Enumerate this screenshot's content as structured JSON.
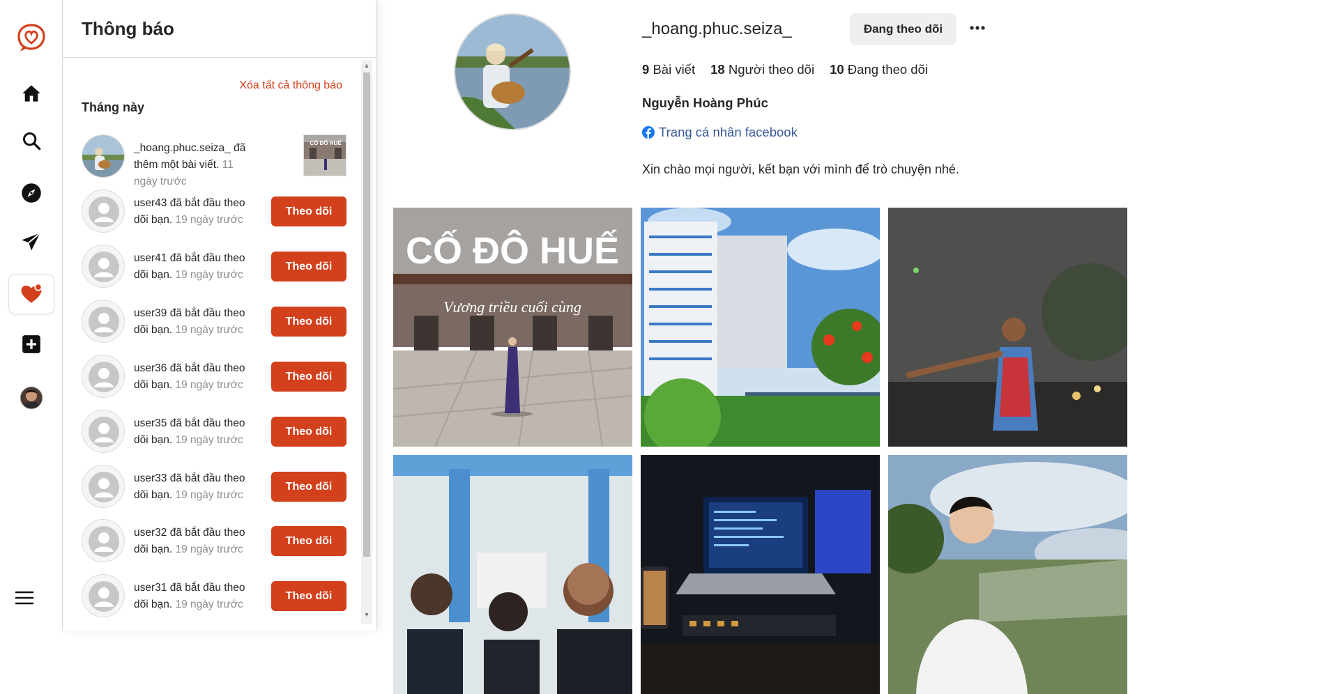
{
  "nav": {
    "logo": "brand-logo",
    "items": [
      "home-icon",
      "search-icon",
      "compass-icon",
      "send-icon",
      "heart-icon",
      "plus-square-icon",
      "avatar"
    ],
    "menu": "menu-icon",
    "accent": "#d2401c"
  },
  "notifications": {
    "title": "Thông báo",
    "clear_all": "Xóa tất cả thông báo",
    "section": "Tháng này",
    "first": {
      "user": "_hoang.phuc.seiza_",
      "action": " đã thêm một bài viết.",
      "time": " 11 ngày trước"
    },
    "items": [
      {
        "user": "user43",
        "action": " đã bắt đầu theo dõi bạn.",
        "time": " 19 ngày trước",
        "button": "Theo dõi"
      },
      {
        "user": "user41",
        "action": " đã bắt đầu theo dõi bạn.",
        "time": " 19 ngày trước",
        "button": "Theo dõi"
      },
      {
        "user": "user39",
        "action": " đã bắt đầu theo dõi bạn.",
        "time": " 19 ngày trước",
        "button": "Theo dõi"
      },
      {
        "user": "user36",
        "action": " đã bắt đầu theo dõi bạn.",
        "time": " 19 ngày trước",
        "button": "Theo dõi"
      },
      {
        "user": "user35",
        "action": " đã bắt đầu theo dõi bạn.",
        "time": " 19 ngày trước",
        "button": "Theo dõi"
      },
      {
        "user": "user33",
        "action": " đã bắt đầu theo dõi bạn.",
        "time": " 19 ngày trước",
        "button": "Theo dõi"
      },
      {
        "user": "user32",
        "action": " đã bắt đầu theo dõi bạn.",
        "time": " 19 ngày trước",
        "button": "Theo dõi"
      },
      {
        "user": "user31",
        "action": " đã bắt đầu theo dõi bạn.",
        "time": " 19 ngày trước",
        "button": "Theo dõi"
      }
    ]
  },
  "profile": {
    "username": "_hoang.phuc.seiza_",
    "following_button": "Đang theo dõi",
    "posts_count": "9",
    "posts_label": "Bài viết",
    "followers_count": "18",
    "followers_label": "Người theo dõi",
    "following_count": "10",
    "following_label": "Đang theo dõi",
    "full_name": "Nguyễn Hoàng Phúc",
    "facebook_link": "Trang cá nhân facebook",
    "bio": "Xin chào mọi người, kết bạn với mình để trò chuyện nhé."
  },
  "posts": {
    "post1_title": "CỐ ĐÔ HUẾ",
    "post1_subtitle": "Vương triều cuối cùng"
  }
}
